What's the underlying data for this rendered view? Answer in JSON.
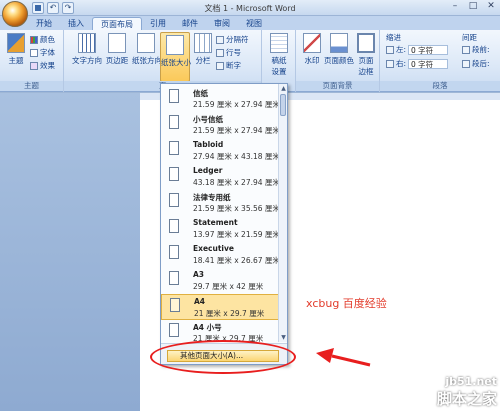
{
  "window": {
    "title": "文档 1 - Microsoft Word",
    "minimize": "–",
    "maximize": "□",
    "close": "✕"
  },
  "tabs": [
    {
      "label": "开始",
      "active": false
    },
    {
      "label": "插入",
      "active": false
    },
    {
      "label": "页面布局",
      "active": true
    },
    {
      "label": "引用",
      "active": false
    },
    {
      "label": "邮件",
      "active": false
    },
    {
      "label": "审阅",
      "active": false
    },
    {
      "label": "视图",
      "active": false
    }
  ],
  "ribbon": {
    "themes": {
      "group_label": "主题",
      "theme_btn": "主题",
      "colors": "颜色",
      "fonts": "字体",
      "effects": "效果"
    },
    "page_setup": {
      "group_label": "页",
      "text_direction": "文字方向",
      "margins": "页边距",
      "orientation": "纸张方向",
      "size": "纸张大小",
      "columns": "分栏",
      "breaks": "分隔符",
      "line_numbers": "行号",
      "hyphenation": "断字"
    },
    "paper": {
      "manuscript": "稿纸",
      "setup": "设置"
    },
    "page_background": {
      "group_label": "页面背景",
      "watermark": "水印",
      "page_color": "页面颜色",
      "page_borders": "页面",
      "page_borders_2": "边框"
    },
    "paragraph": {
      "group_label": "段落",
      "indent_label": "缩进",
      "left_label": "左:",
      "left_value": "0 字符",
      "right_label": "右:",
      "right_value": "0 字符",
      "spacing_label": "间距",
      "before_label": "段前:",
      "after_label": "段后:"
    }
  },
  "paper_sizes": [
    {
      "name": "信纸",
      "dims": "21.59 厘米 x 27.94 厘米",
      "selected": false
    },
    {
      "name": "小号信纸",
      "dims": "21.59 厘米 x 27.94 厘米",
      "selected": false
    },
    {
      "name": "Tabloid",
      "dims": "27.94 厘米 x 43.18 厘米",
      "selected": false
    },
    {
      "name": "Ledger",
      "dims": "43.18 厘米 x 27.94 厘米",
      "selected": false
    },
    {
      "name": "法律专用纸",
      "dims": "21.59 厘米 x 35.56 厘米",
      "selected": false
    },
    {
      "name": "Statement",
      "dims": "13.97 厘米 x 21.59 厘米",
      "selected": false
    },
    {
      "name": "Executive",
      "dims": "18.41 厘米 x 26.67 厘米",
      "selected": false
    },
    {
      "name": "A3",
      "dims": "29.7 厘米 x 42 厘米",
      "selected": false
    },
    {
      "name": "A4",
      "dims": "21 厘米 x 29.7 厘米",
      "selected": true
    },
    {
      "name": "A4 小号",
      "dims": "21 厘米 x 29.7 厘米",
      "selected": false
    }
  ],
  "dropdown": {
    "more_sizes": "其他页面大小(A)..."
  },
  "annotation": {
    "text": "xcbug 百度经验"
  },
  "watermark": {
    "url": "jb51.net",
    "name": "脚本之家"
  }
}
